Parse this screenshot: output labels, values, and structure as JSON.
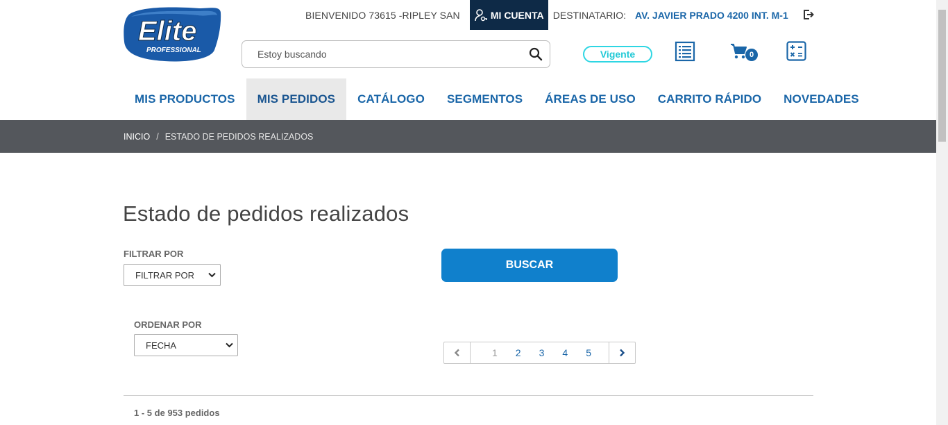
{
  "brand": {
    "logo_text": "Elite",
    "logo_subtext": "PROFESSIONAL",
    "primary_color": "#1a66a8",
    "dark_color": "#0e2a47"
  },
  "top_bar": {
    "welcome": "BIENVENIDO 73615 -RIPLEY SAN",
    "account_label": "MI CUENTA",
    "recipient_label": "DESTINATARIO:",
    "recipient_value": "AV. JAVIER PRADO 4200 INT. M-1"
  },
  "search": {
    "placeholder": "Estoy buscando"
  },
  "status_badge": "Vigente",
  "cart": {
    "count": "0"
  },
  "nav": {
    "items": [
      {
        "label": "MIS PRODUCTOS"
      },
      {
        "label": "MIS PEDIDOS",
        "active": true
      },
      {
        "label": "CATÁLOGO"
      },
      {
        "label": "SEGMENTOS"
      },
      {
        "label": "ÁREAS DE USO"
      },
      {
        "label": "CARRITO RÁPIDO"
      },
      {
        "label": "NOVEDADES"
      }
    ]
  },
  "breadcrumb": {
    "home": "INICIO",
    "separator": "/",
    "current": "ESTADO DE PEDIDOS REALIZADOS"
  },
  "main": {
    "title": "Estado de pedidos realizados",
    "filter": {
      "label": "FILTRAR POR",
      "selected": "FILTRAR POR"
    },
    "sort": {
      "label": "ORDENAR POR",
      "selected": "FECHA"
    },
    "search_button": "BUSCAR",
    "pagination": {
      "pages": [
        "1",
        "2",
        "3",
        "4",
        "5"
      ],
      "current": "1"
    },
    "results_count": "1 - 5 de 953 pedidos"
  }
}
